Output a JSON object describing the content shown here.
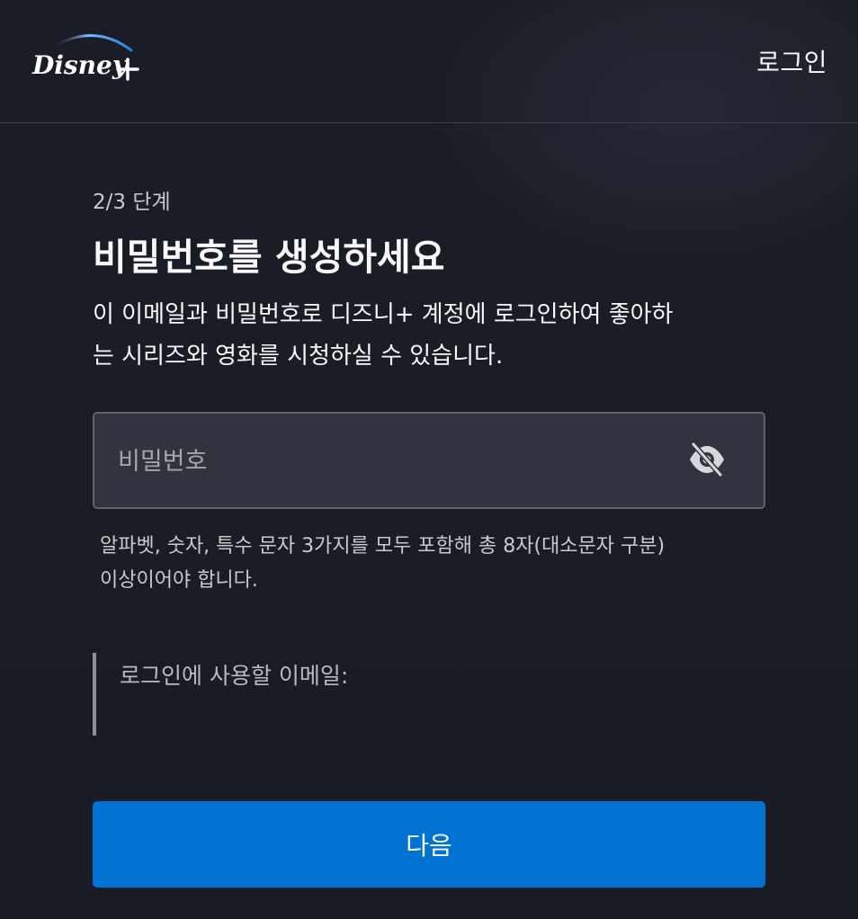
{
  "header": {
    "logo_text": "Disney+",
    "login_label": "로그인"
  },
  "main": {
    "step": "2/3 단계",
    "title": "비밀번호를 생성하세요",
    "description_line1": "이 이메일과 비밀번호로 디즈니+ 계정에 로그인하여 좋아하",
    "description_line2": "는 시리즈와 영화를 시청하실 수 있습니다.",
    "password": {
      "placeholder": "비밀번호",
      "value": "",
      "toggle_icon": "eye-slash-icon"
    },
    "hint_line1": "알파벳, 숫자, 특수 문자 3가지를 모두 포함해 총 8자(대소문자 구분)",
    "hint_line2": "이상이어야 합니다.",
    "email_label": "로그인에 사용할 이메일:",
    "email_value": "",
    "next_label": "다음"
  },
  "colors": {
    "background": "#1a1c25",
    "primary_button": "#0072d2",
    "input_background": "#31343e"
  }
}
